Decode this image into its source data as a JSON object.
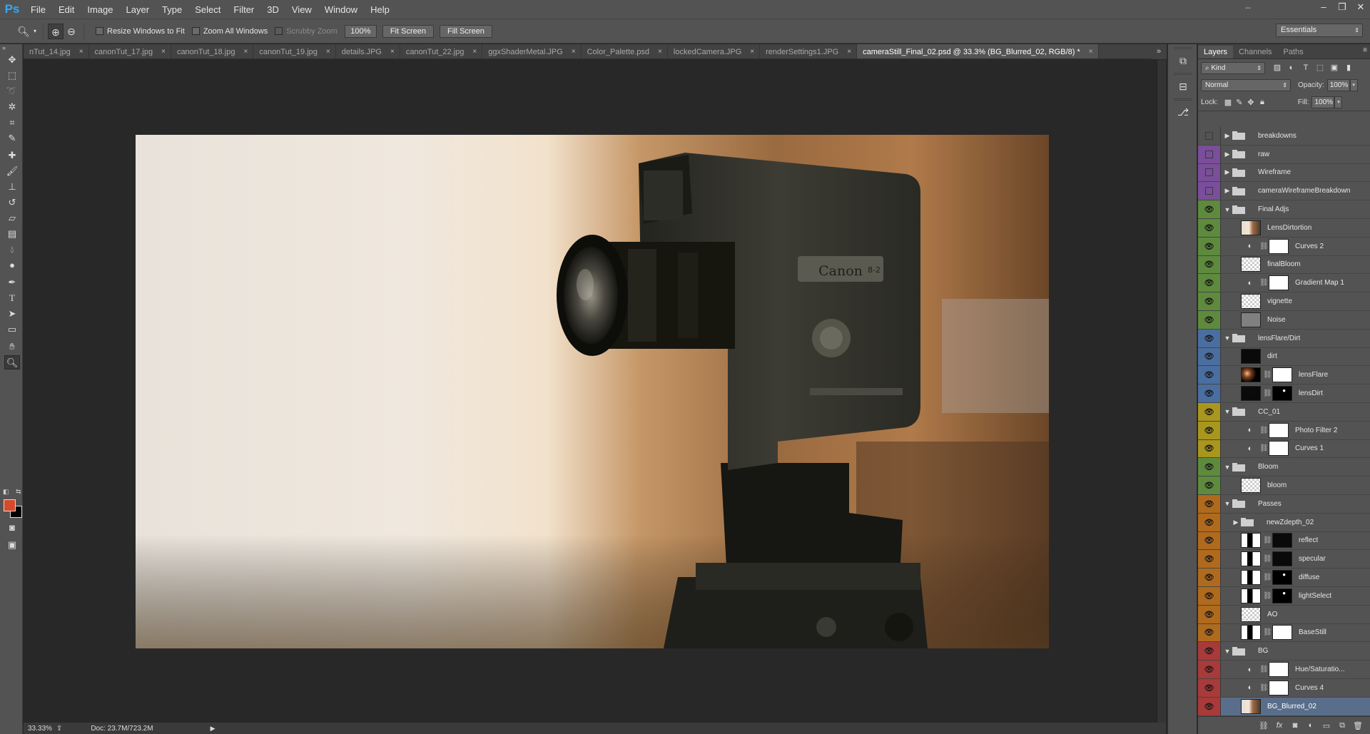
{
  "app": {
    "logo": "Ps"
  },
  "menu": [
    "File",
    "Edit",
    "Image",
    "Layer",
    "Type",
    "Select",
    "Filter",
    "3D",
    "View",
    "Window",
    "Help"
  ],
  "window_controls": {
    "arrange": "⇔",
    "minimize": "–",
    "restore": "❐",
    "close": "✕"
  },
  "options_bar": {
    "tool_icon": "zoom-icon",
    "resize_windows": "Resize Windows to Fit",
    "zoom_all": "Zoom All Windows",
    "scrubby": "Scrubby Zoom",
    "zoom_value": "100%",
    "fit_screen": "Fit Screen",
    "fill_screen": "Fill Screen",
    "workspace": "Essentials"
  },
  "tabs": [
    {
      "label": "nTut_14.jpg",
      "active": false
    },
    {
      "label": "canonTut_17.jpg",
      "active": false
    },
    {
      "label": "canonTut_18.jpg",
      "active": false
    },
    {
      "label": "canonTut_19.jpg",
      "active": false
    },
    {
      "label": "details.JPG",
      "active": false
    },
    {
      "label": "canonTut_22.jpg",
      "active": false
    },
    {
      "label": "ggxShaderMetal.JPG",
      "active": false
    },
    {
      "label": "Color_Palette.psd",
      "active": false
    },
    {
      "label": "lockedCamera.JPG",
      "active": false
    },
    {
      "label": "renderSettings1.JPG",
      "active": false
    },
    {
      "label": "cameraStill_Final_02.psd @ 33.3% (BG_Blurred_02, RGB/8) *",
      "active": true
    }
  ],
  "tab_close": "×",
  "tab_overflow": "»",
  "status": {
    "zoom": "33.33%",
    "doc": "Doc: 23.7M/723.2M"
  },
  "colors": {
    "foreground": "#d54a2b",
    "background": "#000000"
  },
  "layers_panel": {
    "tabs": [
      "Layers",
      "Channels",
      "Paths"
    ],
    "filter": "Kind",
    "blend_mode": "Normal",
    "opacity_label": "Opacity:",
    "opacity": "100%",
    "lock_label": "Lock:",
    "fill_label": "Fill:",
    "fill": "100%"
  },
  "layers": [
    {
      "name": "breakdowns",
      "type": "group",
      "indent": 0,
      "open": false,
      "color": "#535353",
      "visible": false
    },
    {
      "name": "raw",
      "type": "group",
      "indent": 0,
      "open": false,
      "color": "#7a4e9a",
      "visible": false
    },
    {
      "name": "Wireframe",
      "type": "group",
      "indent": 0,
      "open": false,
      "color": "#7a4e9a",
      "visible": false
    },
    {
      "name": "cameraWireframeBreakdown",
      "type": "group",
      "indent": 0,
      "open": false,
      "color": "#7a4e9a",
      "visible": false
    },
    {
      "name": "Final Adjs",
      "type": "group",
      "indent": 0,
      "open": true,
      "color": "#5e8a3e",
      "visible": true
    },
    {
      "name": "LensDirtortion",
      "type": "layer",
      "thumb": "photo",
      "indent": 1,
      "color": "#5e8a3e",
      "visible": true
    },
    {
      "name": "Curves 2",
      "type": "adjust",
      "icon": "◐",
      "mask": "white",
      "indent": 1,
      "color": "#5e8a3e",
      "visible": true
    },
    {
      "name": "finalBloom",
      "type": "layer",
      "thumb": "trans",
      "indent": 1,
      "color": "#5e8a3e",
      "visible": true
    },
    {
      "name": "Gradient Map 1",
      "type": "adjust",
      "icon": "◐",
      "mask": "white",
      "indent": 1,
      "color": "#5e8a3e",
      "visible": true
    },
    {
      "name": "vignette",
      "type": "layer",
      "thumb": "trans",
      "indent": 1,
      "color": "#5e8a3e",
      "visible": true
    },
    {
      "name": "Noise",
      "type": "layer",
      "thumb": "grey",
      "indent": 1,
      "color": "#5e8a3e",
      "visible": true
    },
    {
      "name": "lensFlare/Dirt",
      "type": "group",
      "indent": 0,
      "open": true,
      "color": "#4a6ea0",
      "visible": true
    },
    {
      "name": "dirt",
      "type": "layer",
      "thumb": "dark",
      "indent": 1,
      "color": "#4a6ea0",
      "visible": true
    },
    {
      "name": "lensFlare",
      "type": "masked",
      "thumb": "flare",
      "mask": "white",
      "indent": 1,
      "color": "#4a6ea0",
      "visible": true
    },
    {
      "name": "lensDirt",
      "type": "masked",
      "thumb": "dark",
      "mask": "mask-dots",
      "indent": 1,
      "color": "#4a6ea0",
      "visible": true
    },
    {
      "name": "CC_01",
      "type": "group",
      "indent": 0,
      "open": true,
      "color": "#a8961e",
      "visible": true
    },
    {
      "name": "Photo Filter 2",
      "type": "adjust",
      "icon": "◐",
      "mask": "white",
      "indent": 1,
      "color": "#a8961e",
      "visible": true
    },
    {
      "name": "Curves 1",
      "type": "adjust",
      "icon": "◐",
      "mask": "white",
      "indent": 1,
      "color": "#a8961e",
      "visible": true
    },
    {
      "name": "Bloom",
      "type": "group",
      "indent": 0,
      "open": true,
      "color": "#5e8a3e",
      "visible": true
    },
    {
      "name": "bloom",
      "type": "layer",
      "thumb": "trans",
      "indent": 1,
      "color": "#5e8a3e",
      "visible": true
    },
    {
      "name": "Passes",
      "type": "group",
      "indent": 0,
      "open": true,
      "color": "#b06a1e",
      "visible": true
    },
    {
      "name": "newZdepth_02",
      "type": "group",
      "indent": 1,
      "open": false,
      "color": "#b06a1e",
      "visible": true
    },
    {
      "name": "reflect",
      "type": "masked",
      "thumb": "mask-pass",
      "mask": "dark",
      "indent": 1,
      "color": "#b06a1e",
      "visible": true
    },
    {
      "name": "specular",
      "type": "masked",
      "thumb": "mask-pass",
      "mask": "dark",
      "indent": 1,
      "color": "#b06a1e",
      "visible": true
    },
    {
      "name": "diffuse",
      "type": "masked",
      "thumb": "mask-pass",
      "mask": "mask-dots",
      "indent": 1,
      "color": "#b06a1e",
      "visible": true
    },
    {
      "name": "lightSelect",
      "type": "masked",
      "thumb": "mask-pass",
      "mask": "mask-dots",
      "indent": 1,
      "color": "#b06a1e",
      "visible": true
    },
    {
      "name": "AO",
      "type": "layer",
      "thumb": "trans",
      "indent": 1,
      "color": "#b06a1e",
      "visible": true
    },
    {
      "name": "BaseStill",
      "type": "masked",
      "thumb": "mask-pass",
      "mask": "white",
      "indent": 1,
      "color": "#b06a1e",
      "visible": true
    },
    {
      "name": "BG",
      "type": "group",
      "indent": 0,
      "open": true,
      "color": "#a83a3a",
      "visible": true
    },
    {
      "name": "Hue/Saturatio...",
      "type": "adjust",
      "icon": "◐",
      "mask": "white",
      "indent": 1,
      "color": "#a83a3a",
      "visible": true
    },
    {
      "name": "Curves 4",
      "type": "adjust",
      "icon": "◐",
      "mask": "white",
      "indent": 1,
      "color": "#a83a3a",
      "visible": true
    },
    {
      "name": "BG_Blurred_02",
      "type": "layer",
      "thumb": "photo",
      "indent": 1,
      "color": "#a83a3a",
      "visible": true,
      "selected": true
    }
  ],
  "artwork": {
    "brand": "Canon",
    "model": "ZOOM 8-2"
  }
}
